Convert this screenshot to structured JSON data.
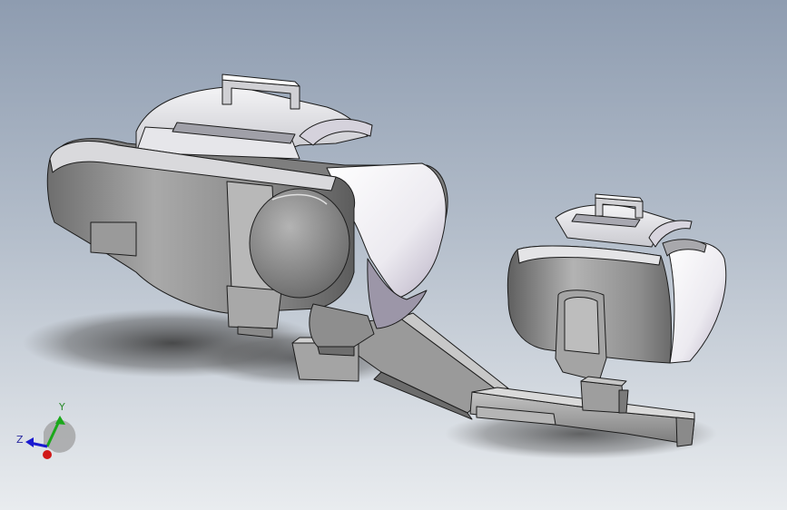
{
  "viewport": {
    "background_top": "#8e9cb0",
    "background_bottom": "#e9ecef"
  },
  "model": {
    "part_color": "#8d8d8d",
    "inner_color": "#f2f2f4",
    "edge_color": "#1c1c1c"
  },
  "orientation_triad": {
    "y_label": "Y",
    "z_label": "Z",
    "x_color": "#d01818",
    "y_color": "#1aa81a",
    "z_color": "#1a1ad0"
  }
}
